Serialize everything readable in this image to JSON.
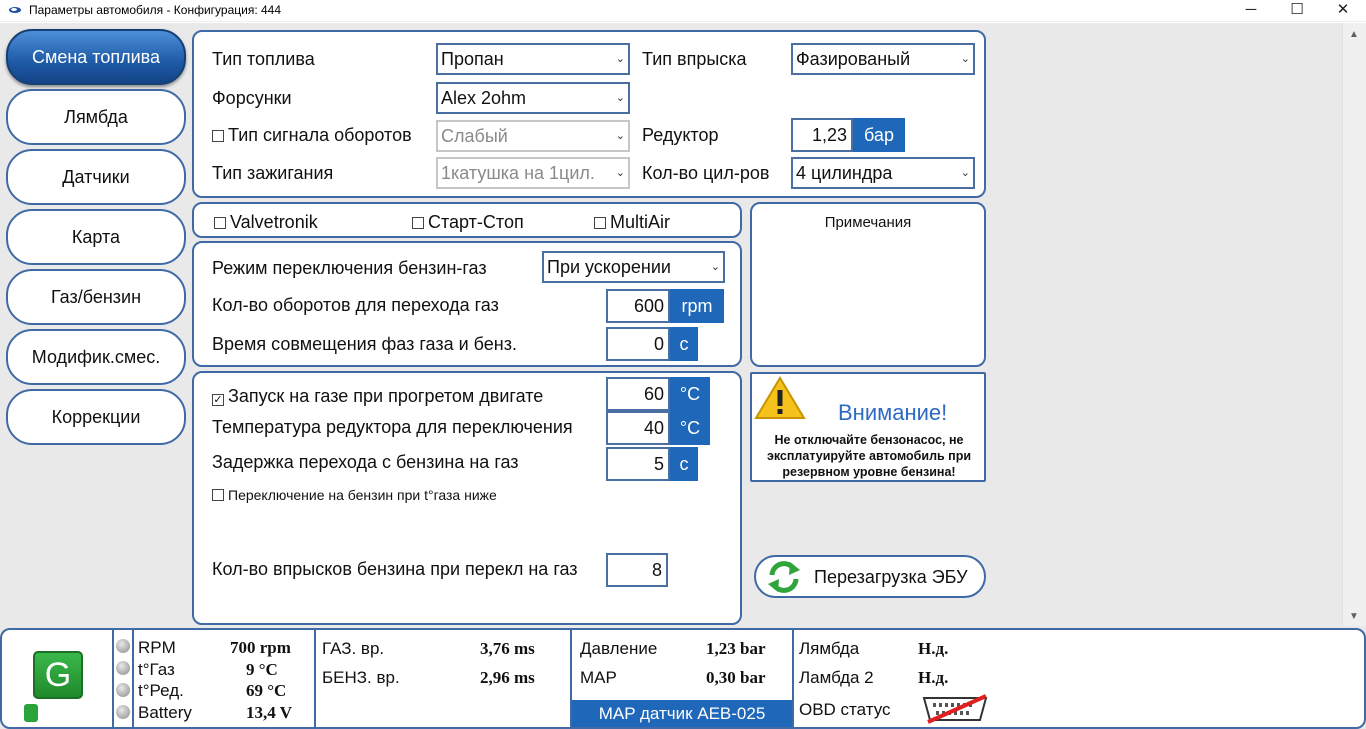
{
  "window": {
    "title": "Параметры автомобиля - Конфигурация: 444",
    "minimize": "─",
    "maximize": "☐",
    "close": "✕"
  },
  "nav": [
    {
      "label": "Смена топлива",
      "active": true
    },
    {
      "label": "Лямбда"
    },
    {
      "label": "Датчики"
    },
    {
      "label": "Карта"
    },
    {
      "label": "Газ/бензин"
    },
    {
      "label": "Модифик.смес."
    },
    {
      "label": "Коррекции"
    }
  ],
  "fuel": {
    "fuel_type_label": "Тип топлива",
    "fuel_type_value": "Пропан",
    "injection_type_label": "Тип впрыска",
    "injection_type_value": "Фазированый",
    "injectors_label": "Форсунки",
    "injectors_value": "Alex 2ohm",
    "rpm_signal_label": "Тип сигнала оборотов",
    "rpm_signal_value": "Слабый",
    "reducer_label": "Редуктор",
    "reducer_value": "1,23",
    "reducer_unit": "бар",
    "ignition_label": "Тип зажигания",
    "ignition_value": "1катушка на 1цил.",
    "cylinders_label": "Кол-во цил-ров",
    "cylinders_value": "4 цилиндра"
  },
  "options": {
    "valvetronik": "Valvetronik",
    "start_stop": "Старт-Стоп",
    "multiair": "MultiAir"
  },
  "switching": {
    "mode_label": "Режим переключения бензин-газ",
    "mode_value": "При ускорении",
    "rpm_label": "Кол-во оборотов для перехода газ",
    "rpm_value": "600",
    "rpm_unit": "rpm",
    "overlap_label": "Время совмещения фаз газа и бенз.",
    "overlap_value": "0",
    "overlap_unit": "c"
  },
  "start": {
    "warm_start_label": "Запуск на газе при прогретом двигате",
    "warm_start_checked": true,
    "warm_start_value": "60",
    "warm_start_unit": "°C",
    "reducer_temp_label": "Температура редуктора для переключения",
    "reducer_temp_value": "40",
    "reducer_temp_unit": "°C",
    "delay_label": "Задержка перехода с бензина на газ",
    "delay_value": "5",
    "delay_unit": "c",
    "switch_back_label": "Переключение на бензин при t°газа ниже",
    "injections_label": "Кол-во впрысков бензина при перекл на газ",
    "injections_value": "8"
  },
  "notes": {
    "title": "Примечания"
  },
  "warning": {
    "title": "Внимание!",
    "text": "Не отключайте бензонасос, не эксплатуируйте автомобиль при резервном уровне бензина!"
  },
  "reload": {
    "label": "Перезагрузка ЭБУ"
  },
  "status": {
    "logo": "G",
    "rpm_label": "RPM",
    "rpm_value": "700 rpm",
    "tgas_label": "t°Газ",
    "tgas_value": "9 °C",
    "tred_label": "t°Ред.",
    "tred_value": "69 °C",
    "battery_label": "Battery",
    "battery_value": "13,4 V",
    "gas_time_label": "ГАЗ. вр.",
    "gas_time_value": "3,76 ms",
    "petrol_time_label": "БЕНЗ. вр.",
    "petrol_time_value": "2,96 ms",
    "pressure_label": "Давление",
    "pressure_value": "1,23 bar",
    "map_label": "MAP",
    "map_value": "0,30 bar",
    "map_sensor": "MAP датчик AEB-025",
    "lambda_label": "Лямбда",
    "lambda_value": "Н.д.",
    "lambda2_label": "Ламбда 2",
    "lambda2_value": "Н.д.",
    "obd_label": "OBD статус"
  }
}
